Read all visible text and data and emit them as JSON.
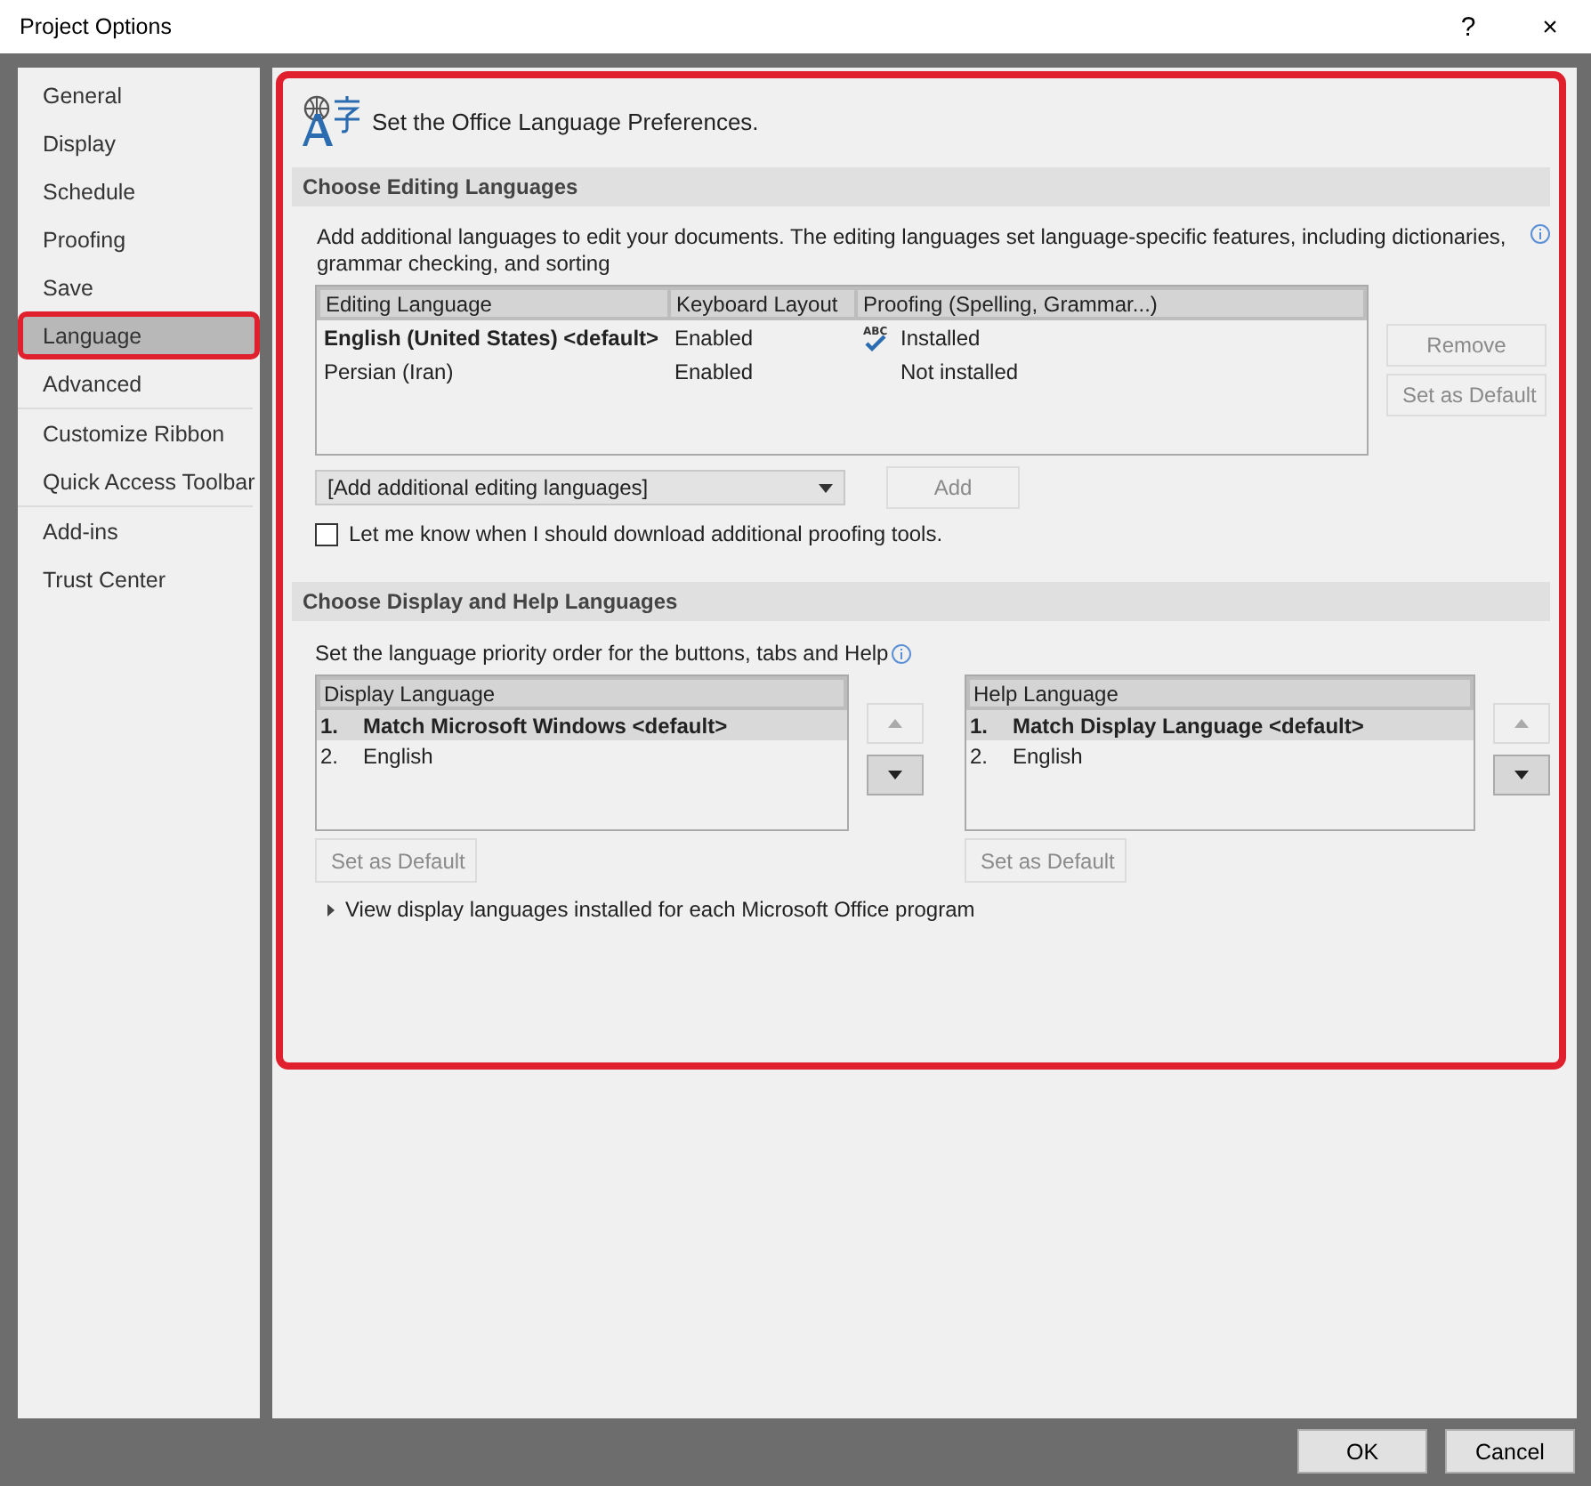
{
  "window": {
    "title": "Project Options",
    "buttons": [
      "?",
      "×"
    ]
  },
  "sidebar": {
    "groups": [
      [
        {
          "label": "General",
          "selected": false,
          "highlighted": false
        },
        {
          "label": "Display",
          "selected": false,
          "highlighted": false
        },
        {
          "label": "Schedule",
          "selected": false,
          "highlighted": false
        },
        {
          "label": "Proofing",
          "selected": false,
          "highlighted": false
        },
        {
          "label": "Save",
          "selected": false,
          "highlighted": false
        },
        {
          "label": "Language",
          "selected": true,
          "highlighted": true
        },
        {
          "label": "Advanced",
          "selected": false,
          "highlighted": false
        }
      ],
      [
        {
          "label": "Customize Ribbon",
          "selected": false,
          "highlighted": false
        },
        {
          "label": "Quick Access Toolbar",
          "selected": false,
          "highlighted": false
        }
      ],
      [
        {
          "label": "Add-ins",
          "selected": false,
          "highlighted": false
        },
        {
          "label": "Trust Center",
          "selected": false,
          "highlighted": false
        }
      ]
    ]
  },
  "content": {
    "highlighted": true,
    "heading": "Set the Office Language Preferences.",
    "editing": {
      "title": "Choose Editing Languages",
      "description": "Add additional languages to edit your documents. The editing languages set language-specific features, including dictionaries, grammar checking, and sorting",
      "columns": [
        "Editing Language",
        "Keyboard Layout",
        "Proofing (Spelling, Grammar...)"
      ],
      "rows": [
        {
          "language": "English (United States) <default>",
          "keyboard": "Enabled",
          "proofing": "Installed",
          "proofing_icon_text": "ABC",
          "installed": true,
          "is_default": true
        },
        {
          "language": "Persian (Iran)",
          "keyboard": "Enabled",
          "proofing": "Not installed",
          "installed": false,
          "is_default": false
        }
      ],
      "side_buttons": [
        {
          "label": "Remove",
          "disabled": true
        },
        {
          "label": "Set as Default",
          "disabled": true
        }
      ],
      "dropdown": "[Add additional editing languages]",
      "add_button": {
        "label": "Add",
        "disabled": true
      },
      "checkbox": {
        "label": "Let me know when I should download additional proofing tools.",
        "checked": false
      }
    },
    "display": {
      "title": "Choose Display and Help Languages",
      "description": "Set the language priority order for the buttons, tabs and Help",
      "lists": [
        {
          "header": "Display Language",
          "items": [
            {
              "number": "1.",
              "label": "Match Microsoft Windows <default>",
              "selected": true
            },
            {
              "number": "2.",
              "label": "English",
              "selected": false
            }
          ],
          "up_disabled": true,
          "down_disabled": false,
          "button": {
            "label": "Set as Default",
            "disabled": true
          }
        },
        {
          "header": "Help Language",
          "items": [
            {
              "number": "1.",
              "label": "Match Display Language <default>",
              "selected": true
            },
            {
              "number": "2.",
              "label": "English",
              "selected": false
            }
          ],
          "up_disabled": true,
          "down_disabled": false,
          "button": {
            "label": "Set as Default",
            "disabled": true
          }
        }
      ],
      "link": "View display languages installed for each Microsoft Office program"
    }
  },
  "footer": {
    "buttons": [
      "OK",
      "Cancel"
    ]
  }
}
